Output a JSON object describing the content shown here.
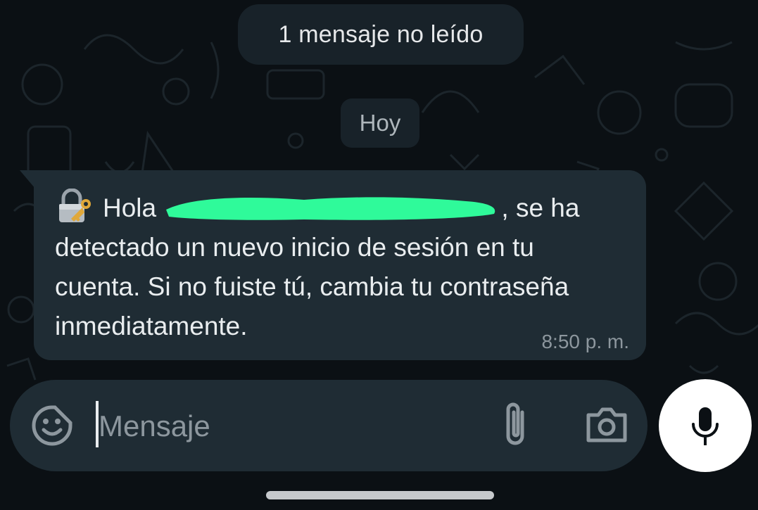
{
  "chat": {
    "unread_banner": "1 mensaje no leído",
    "date_separator": "Hoy",
    "message": {
      "emoji": "lock-with-key-icon",
      "greeting": "Hola",
      "name_redacted": true,
      "text_after_name": ", se ha detectado un nuevo inicio de sesión en tu cuenta. Si no fuiste tú, cambia tu contraseña inmediatamente.",
      "time": "8:50 p. m."
    }
  },
  "composer": {
    "placeholder": "Mensaje",
    "value": ""
  },
  "colors": {
    "background": "#0b1014",
    "bubble": "#1f2c34",
    "text": "#e9edef",
    "muted_text": "#8d979e",
    "redaction": "#2ffa9a",
    "mic_button": "#ffffff"
  }
}
